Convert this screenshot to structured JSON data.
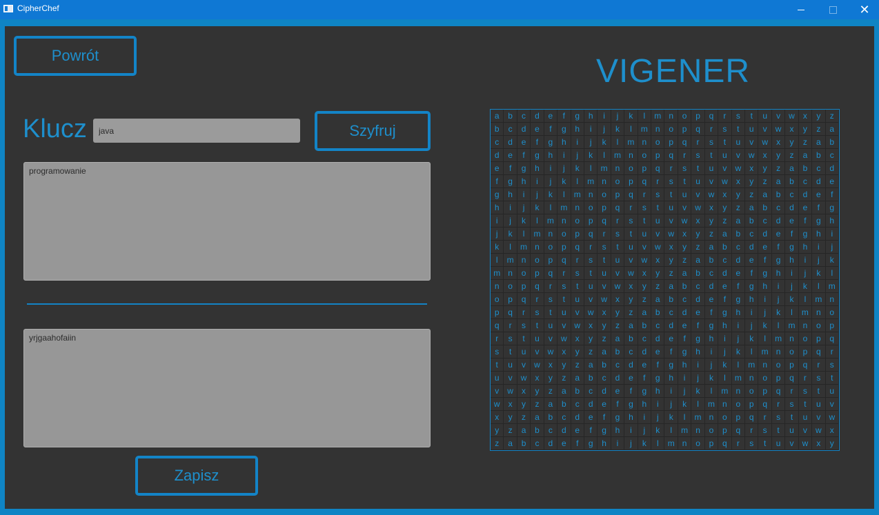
{
  "window": {
    "title": "CipherChef",
    "minimize_glyph": "",
    "close_glyph": "✕"
  },
  "buttons": {
    "back": "Powrót",
    "encrypt": "Szyfruj",
    "save": "Zapisz"
  },
  "key": {
    "label": "Klucz",
    "value": "java"
  },
  "input_text": "programowanie",
  "output_text": "yrjgaahofaiin",
  "vigenere": {
    "title": "VIGENER",
    "alphabet": "abcdefghijklmnopqrstuvwxyz"
  },
  "colors": {
    "accent": "#1384c7",
    "background": "#333333",
    "titlebar": "#0f78d4"
  }
}
